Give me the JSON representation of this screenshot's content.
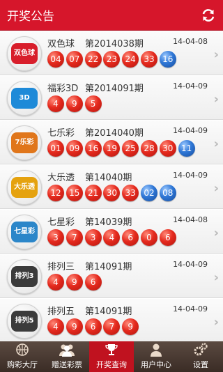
{
  "header": {
    "title": "开奖公告",
    "refresh_icon": "refresh-icon"
  },
  "colors": {
    "brand": "#d6162b",
    "red_ball": "#e52a1e",
    "blue_ball": "#2f77d6"
  },
  "results": [
    {
      "name": "双色球",
      "issue": "第2014038期",
      "date": "14-04-08",
      "logo_text": "双色球",
      "logo_color": "#d81e2b",
      "balls": [
        [
          "04",
          "red"
        ],
        [
          "07",
          "red"
        ],
        [
          "22",
          "red"
        ],
        [
          "23",
          "red"
        ],
        [
          "24",
          "red"
        ],
        [
          "33",
          "red"
        ],
        [
          "16",
          "blue"
        ]
      ]
    },
    {
      "name": "福彩3D",
      "issue": "第2014091期",
      "date": "14-04-09",
      "logo_text": "3D",
      "logo_color": "#1e8ad8",
      "balls": [
        [
          "4",
          "red"
        ],
        [
          "9",
          "red"
        ],
        [
          "5",
          "red"
        ]
      ]
    },
    {
      "name": "七乐彩",
      "issue": "第2014040期",
      "date": "14-04-09",
      "logo_text": "7乐彩",
      "logo_color": "#e0761b",
      "balls": [
        [
          "01",
          "red"
        ],
        [
          "09",
          "red"
        ],
        [
          "16",
          "red"
        ],
        [
          "19",
          "red"
        ],
        [
          "25",
          "red"
        ],
        [
          "28",
          "red"
        ],
        [
          "30",
          "red"
        ],
        [
          "11",
          "blue"
        ]
      ]
    },
    {
      "name": "大乐透",
      "issue": "第14040期",
      "date": "14-04-09",
      "logo_text": "大乐透",
      "logo_color": "#e5a20f",
      "balls": [
        [
          "12",
          "red"
        ],
        [
          "15",
          "red"
        ],
        [
          "21",
          "red"
        ],
        [
          "30",
          "red"
        ],
        [
          "33",
          "red"
        ],
        [
          "02",
          "blue"
        ],
        [
          "08",
          "blue"
        ]
      ]
    },
    {
      "name": "七星彩",
      "issue": "第14039期",
      "date": "14-04-08",
      "logo_text": "七星彩",
      "logo_color": "#2b86c9",
      "balls": [
        [
          "3",
          "red"
        ],
        [
          "7",
          "red"
        ],
        [
          "3",
          "red"
        ],
        [
          "4",
          "red"
        ],
        [
          "6",
          "red"
        ],
        [
          "0",
          "red"
        ],
        [
          "6",
          "red"
        ]
      ]
    },
    {
      "name": "排列三",
      "issue": "第14091期",
      "date": "14-04-09",
      "logo_text": "排列3",
      "logo_color": "#3b3b3b",
      "balls": [
        [
          "4",
          "red"
        ],
        [
          "9",
          "red"
        ],
        [
          "6",
          "red"
        ]
      ]
    },
    {
      "name": "排列五",
      "issue": "第14091期",
      "date": "14-04-09",
      "logo_text": "排列5",
      "logo_color": "#3b3b3b",
      "balls": [
        [
          "4",
          "red"
        ],
        [
          "9",
          "red"
        ],
        [
          "6",
          "red"
        ],
        [
          "7",
          "red"
        ],
        [
          "9",
          "red"
        ]
      ]
    }
  ],
  "tabs": [
    {
      "label": "购彩大厅",
      "icon": "basketball-icon",
      "active": false
    },
    {
      "label": "赠送彩票",
      "icon": "users-icon",
      "active": false
    },
    {
      "label": "开奖查询",
      "icon": "trophy-icon",
      "active": true
    },
    {
      "label": "用户中心",
      "icon": "user-icon",
      "active": false
    },
    {
      "label": "设置",
      "icon": "gear-icon",
      "active": false
    }
  ]
}
